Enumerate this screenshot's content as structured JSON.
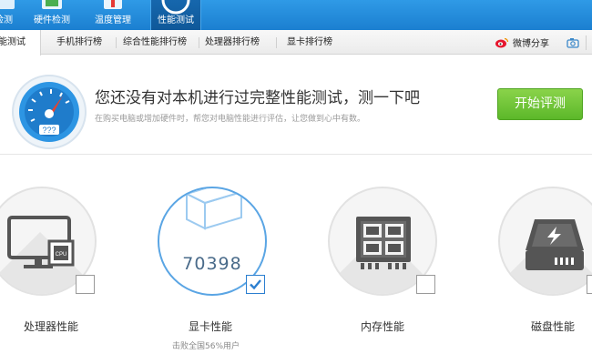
{
  "toolbar": {
    "items": [
      {
        "label": "检测",
        "icon": "monitor-check-icon"
      },
      {
        "label": "硬件检测",
        "icon": "hardware-icon"
      },
      {
        "label": "温度管理",
        "icon": "thermometer-icon"
      },
      {
        "label": "性能测试",
        "icon": "speedometer-icon",
        "active": true
      }
    ]
  },
  "tabs": {
    "items": [
      {
        "label": "性能测试",
        "active": true
      },
      {
        "label": "手机排行榜"
      },
      {
        "label": "综合性能排行榜"
      },
      {
        "label": "处理器排行榜"
      },
      {
        "label": "显卡排行榜"
      }
    ],
    "share_label": "微博分享"
  },
  "banner": {
    "headline": "您还没有对本机进行过完整性能测试，测一下吧",
    "subline": "在购买电脑或增加硬件时，帮您对电脑性能进行评估，让您做到心中有数。",
    "start_button": "开始评测",
    "gauge_text": "???"
  },
  "cards": [
    {
      "label": "处理器性能",
      "icon": "cpu-monitor-icon",
      "checked": false,
      "chip_text": "CPU"
    },
    {
      "label": "显卡性能",
      "icon": "3d-cube-icon",
      "checked": true,
      "score": "70398",
      "beat_text": "击败全国56%用户"
    },
    {
      "label": "内存性能",
      "icon": "ram-module-icon",
      "checked": false
    },
    {
      "label": "磁盘性能",
      "icon": "hard-disk-icon",
      "checked": false
    }
  ],
  "colors": {
    "toolbar_blue": "#1b7fd0",
    "start_green": "#5cb82a",
    "selected_blue": "#2c7fd0"
  }
}
